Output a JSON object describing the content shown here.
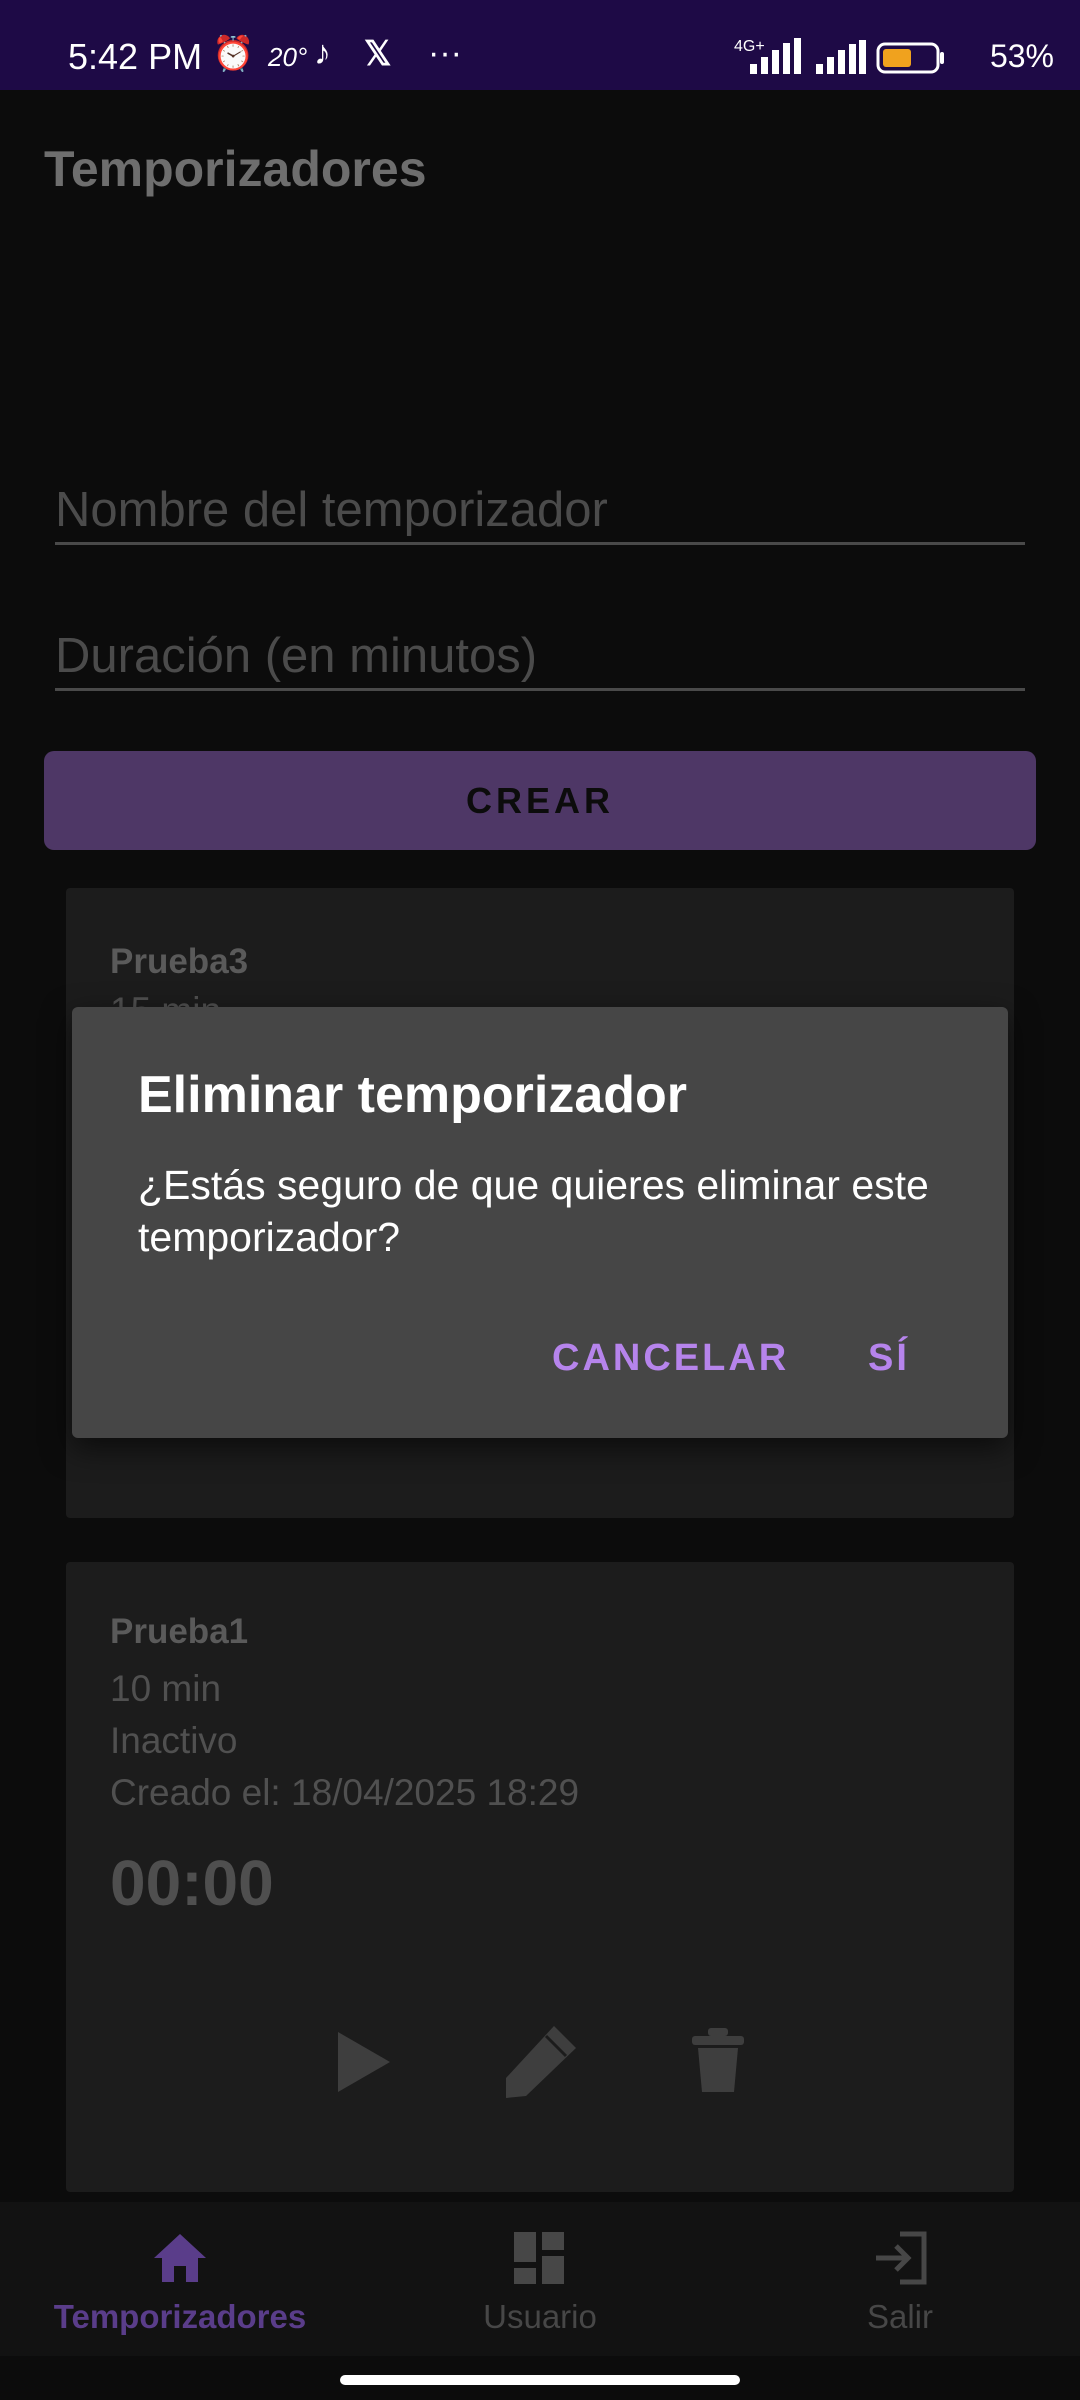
{
  "status_bar": {
    "time": "5:42 PM",
    "temp": "20°",
    "network": "4G+",
    "battery": "53%"
  },
  "app": {
    "title": "Temporizadores",
    "name_placeholder": "Nombre del temporizador",
    "duration_placeholder": "Duración (en minutos)",
    "create_label": "CREAR"
  },
  "timers": [
    {
      "name": "Prueba3",
      "duration": "15 min"
    },
    {
      "name": "Prueba1",
      "duration": "10 min",
      "status": "Inactivo",
      "created": "Creado el: 18/04/2025 18:29",
      "time": "00:00"
    }
  ],
  "dialog": {
    "title": "Eliminar temporizador",
    "message": "¿Estás seguro de que quieres eliminar este temporizador?",
    "cancel": "CANCELAR",
    "confirm": "SÍ"
  },
  "bottom_nav": [
    {
      "label": "Temporizadores",
      "icon": "home-icon",
      "active": true
    },
    {
      "label": "Usuario",
      "icon": "dashboard-icon",
      "active": false
    },
    {
      "label": "Salir",
      "icon": "login-icon",
      "active": false
    }
  ],
  "colors": {
    "accent": "#b684ec",
    "nav_active": "#5a3d8a",
    "status_bar": "#1e0a46"
  }
}
